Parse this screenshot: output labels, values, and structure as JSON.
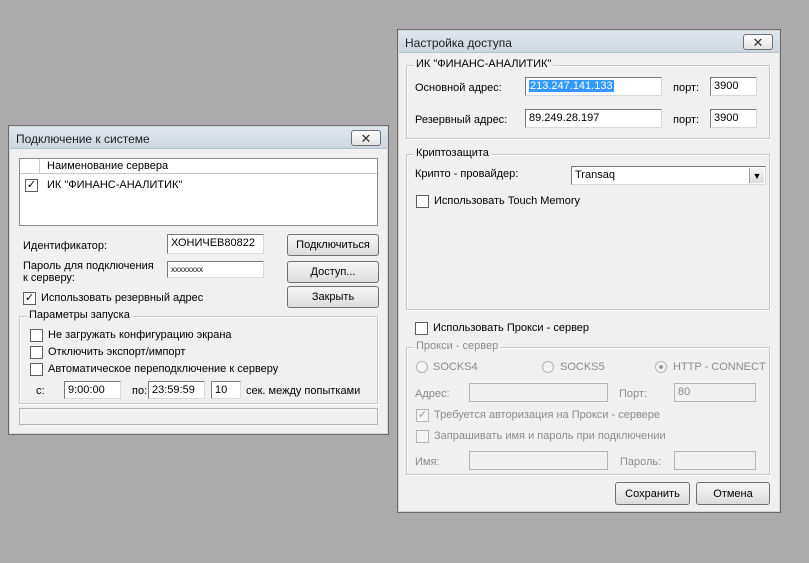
{
  "connect_dialog": {
    "title": "Подключение к системе",
    "server_list": {
      "column_header": "Наименование сервера",
      "rows": [
        {
          "checked": true,
          "name": "ИК \"ФИНАНС-АНАЛИТИК\""
        }
      ]
    },
    "identifier_label": "Идентификатор:",
    "identifier_value": "ХОНИЧЕВ80822",
    "password_label_line1": "Пароль для подключения",
    "password_label_line2": "к серверу:",
    "password_value": "xxxxxxxx",
    "use_backup_label": "Использовать резервный адрес",
    "use_backup_checked": true,
    "buttons": {
      "connect": "Подключиться",
      "access": "Доступ...",
      "close": "Закрыть"
    },
    "startup_group": {
      "title": "Параметры запуска",
      "no_screen_config": "Не загружать конфигурацию экрана",
      "disable_export": "Отключить экспорт/импорт",
      "auto_reconnect": "Автоматическое переподключение к серверу",
      "from_label": "с:",
      "from_value": "9:00:00",
      "to_label": "по:",
      "to_value": "23:59:59",
      "interval_value": "10",
      "interval_label": "сек. между попытками"
    }
  },
  "access_dialog": {
    "title": "Настройка доступа",
    "server_group": {
      "title": "ИК \"ФИНАНС-АНАЛИТИК\"",
      "main_address_label": "Основной адрес:",
      "main_address_value": "213.247.141.133",
      "backup_address_label": "Резервный адрес:",
      "backup_address_value": "89.249.28.197",
      "port_label": "порт:",
      "main_port": "3900",
      "backup_port": "3900"
    },
    "crypto_group": {
      "title": "Криптозащита",
      "provider_label": "Крипто - провайдер:",
      "provider_value": "Transaq",
      "touch_memory_label": "Использовать Touch Memory"
    },
    "use_proxy_label": "Использовать Прокси - сервер",
    "proxy_group": {
      "title": "Прокси - сервер",
      "socks4": "SOCKS4",
      "socks5": "SOCKS5",
      "http_connect": "HTTP - CONNECT",
      "address_label": "Адрес:",
      "port_label": "Порт:",
      "port_value": "80",
      "auth_required": "Требуется авторизация на Прокси - сервере",
      "ask_credentials": "Запрашивать имя и пароль при подключении",
      "name_label": "Имя:",
      "password_label": "Пароль:"
    },
    "buttons": {
      "save": "Сохранить",
      "cancel": "Отмена"
    }
  },
  "icons": {
    "close": "close-icon",
    "check": "check-icon",
    "dropdown": "chevron-down-icon"
  }
}
